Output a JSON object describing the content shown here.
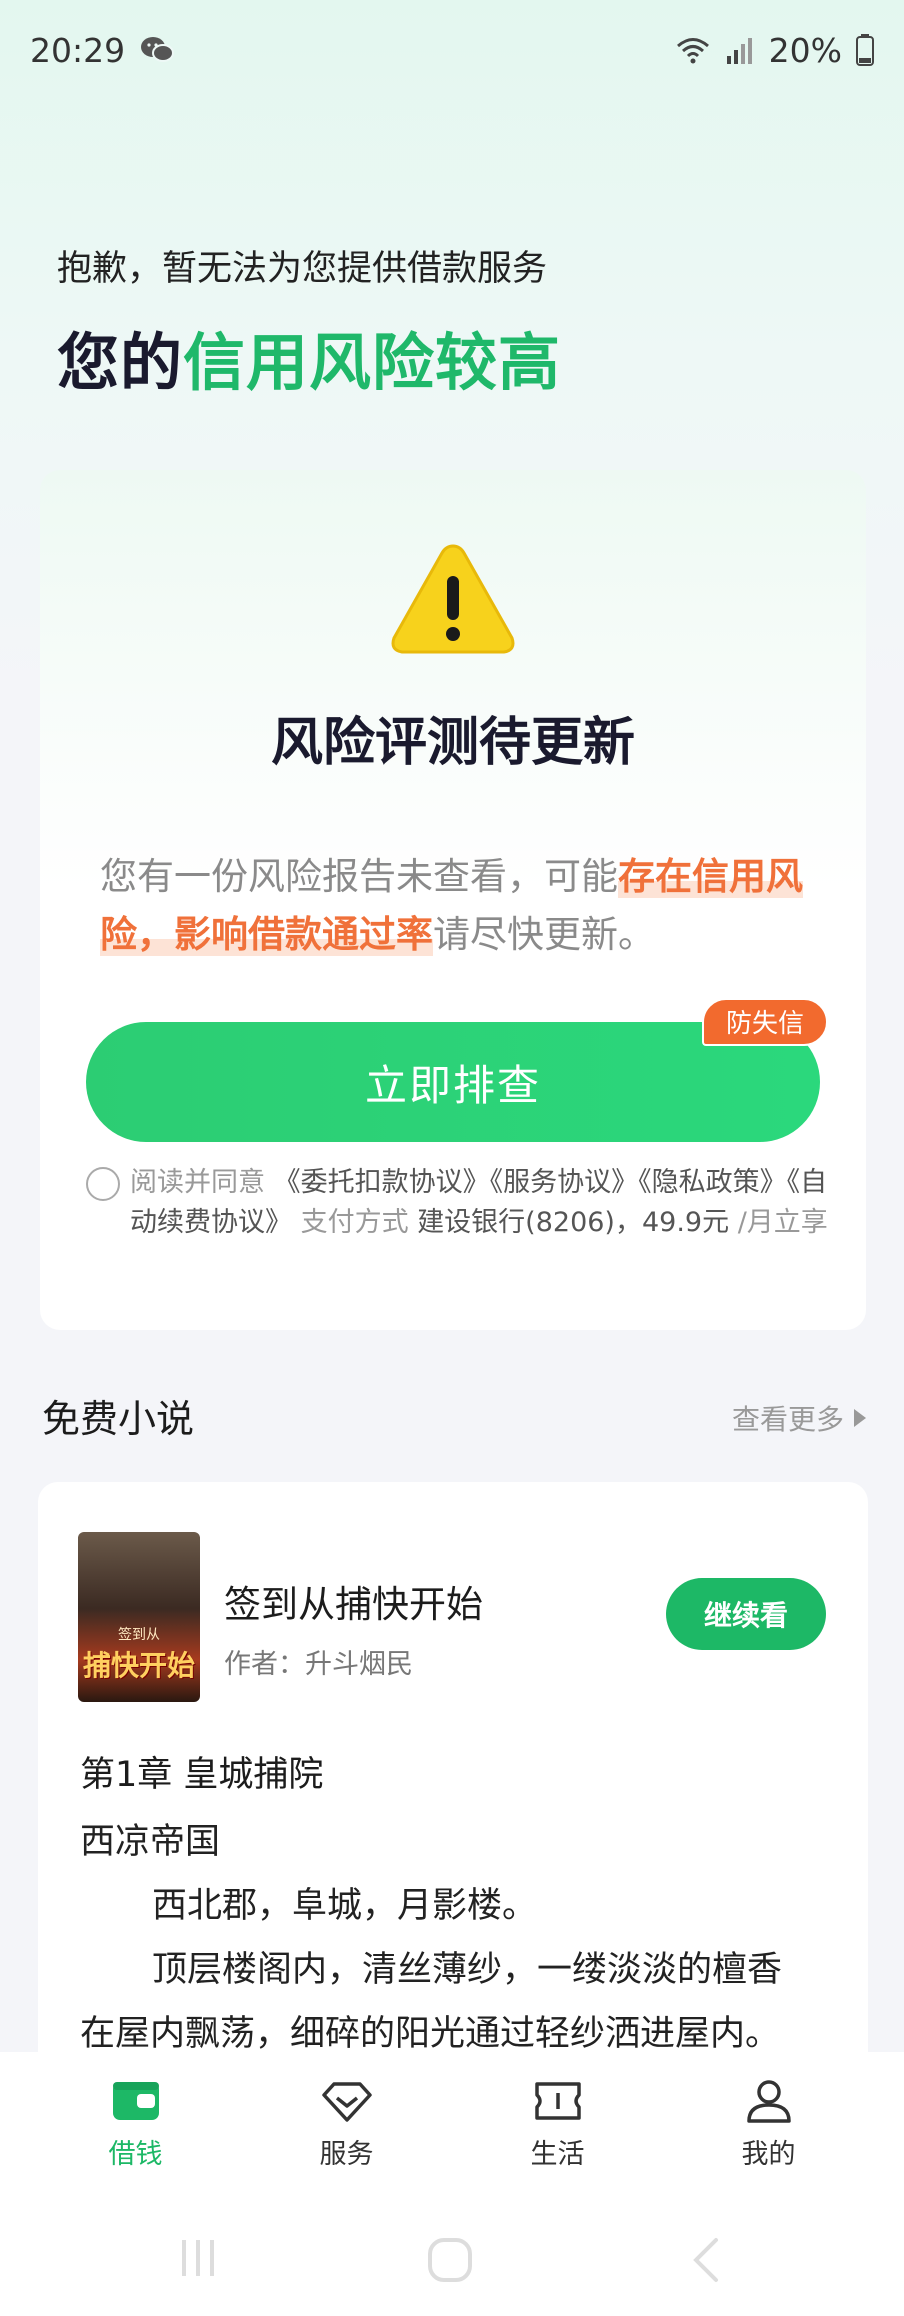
{
  "status": {
    "time": "20:29",
    "battery": "20%"
  },
  "hero": {
    "subtitle": "抱歉，暂无法为您提供借款服务",
    "title_prefix": "您的",
    "title_highlight": "信用风险较高"
  },
  "risk_card": {
    "title": "风险评测待更新",
    "desc_prefix": "您有一份风险报告未查看，可能",
    "desc_highlight": "存在信用风险，影响借款通过率",
    "desc_suffix": "请尽快更新。",
    "button_label": "立即排查",
    "badge": "防失信",
    "agree_prefix": "阅读并同意",
    "agree_docs": "《委托扣款协议》《服务协议》《隐私政策》《自动续费协议》",
    "pay_label": "支付方式",
    "pay_value": "建设银行(8206)，49.9元",
    "pay_suffix": "/月立享"
  },
  "novels": {
    "section_title": "免费小说",
    "more_label": "查看更多",
    "book": {
      "cover_line1": "签到从",
      "cover_line2": "捕快开始",
      "title": "签到从捕快开始",
      "author": "作者：升斗烟民",
      "continue_label": "继续看",
      "chapter": "第1章 皇城捕院",
      "p1": "西凉帝国",
      "p2": "西北郡，阜城，月影楼。",
      "p3": "顶层楼阁内，清丝薄纱，一缕淡淡的檀香",
      "p4": "在屋内飘荡，细碎的阳光通过轻纱洒进屋内。"
    }
  },
  "tabs": [
    {
      "label": "借钱",
      "icon": "wallet-icon",
      "active": true
    },
    {
      "label": "服务",
      "icon": "diamond-icon",
      "active": false
    },
    {
      "label": "生活",
      "icon": "ticket-icon",
      "active": false
    },
    {
      "label": "我的",
      "icon": "user-icon",
      "active": false
    }
  ],
  "colors": {
    "brand_green": "#1db866",
    "warning_orange": "#f26a2e"
  }
}
